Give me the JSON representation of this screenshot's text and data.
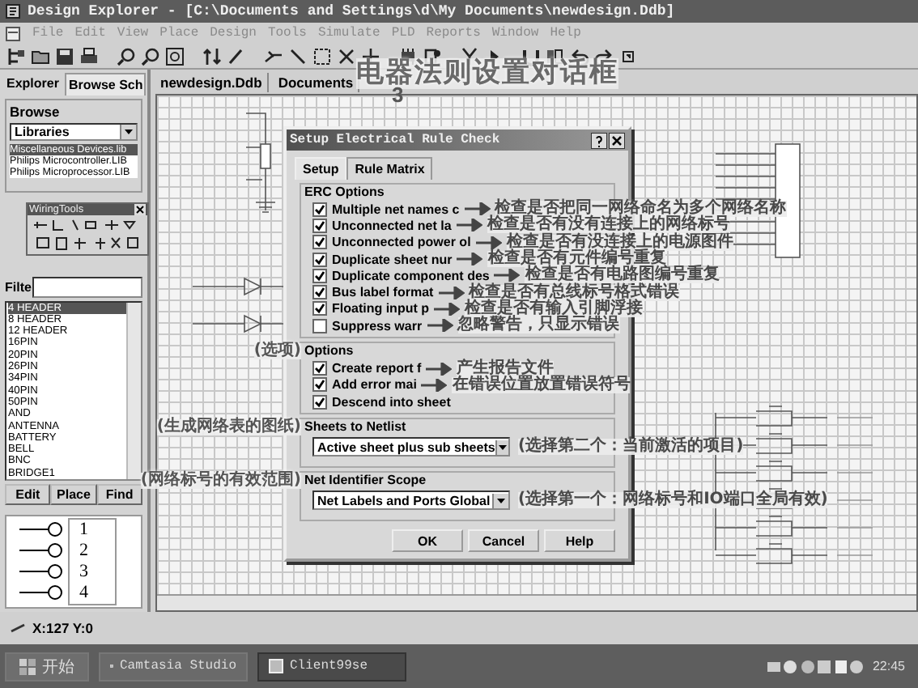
{
  "window": {
    "title": "Design Explorer - [C:\\Documents and Settings\\d\\My Documents\\newdesign.Ddb]"
  },
  "menu": [
    "File",
    "Edit",
    "View",
    "Place",
    "Design",
    "Tools",
    "Simulate",
    "PLD",
    "Reports",
    "Window",
    "Help"
  ],
  "left_panel": {
    "tabs": [
      {
        "label": "Explorer",
        "selected": false
      },
      {
        "label": "Browse Sch",
        "selected": true
      }
    ],
    "browse_label": "Browse",
    "library_select": "Libraries",
    "libraries": [
      {
        "label": "Miscellaneous Devices.lib",
        "selected": true
      },
      {
        "label": "Philips Microcontroller.LIB",
        "selected": false
      },
      {
        "label": "Philips Microprocessor.LIB",
        "selected": false
      }
    ],
    "wiring_tools": {
      "title": "WiringTools"
    },
    "filter_label": "Filte",
    "components": [
      {
        "label": "4 HEADER",
        "selected": true
      },
      {
        "label": "8 HEADER",
        "selected": false
      },
      {
        "label": "12 HEADER",
        "selected": false
      },
      {
        "label": "16PIN",
        "selected": false
      },
      {
        "label": "20PIN",
        "selected": false
      },
      {
        "label": "26PIN",
        "selected": false
      },
      {
        "label": "34PIN",
        "selected": false
      },
      {
        "label": "40PIN",
        "selected": false
      },
      {
        "label": "50PIN",
        "selected": false
      },
      {
        "label": "AND",
        "selected": false
      },
      {
        "label": "ANTENNA",
        "selected": false
      },
      {
        "label": "BATTERY",
        "selected": false
      },
      {
        "label": "BELL",
        "selected": false
      },
      {
        "label": "BNC",
        "selected": false
      },
      {
        "label": "BRIDGE1",
        "selected": false
      }
    ],
    "buttons": [
      "Edit",
      "Place",
      "Find"
    ],
    "preview_pins": [
      "1",
      "2",
      "3",
      "4"
    ]
  },
  "document_tabs": [
    {
      "label": "newdesign.Ddb",
      "selected": false
    },
    {
      "label": "Documents",
      "selected": false
    }
  ],
  "title_annotation": "电器法则设置对话框",
  "title_annotation_mark": "3",
  "dialog": {
    "title": "Setup Electrical Rule Check",
    "tabs": [
      {
        "label": "Setup",
        "selected": true
      },
      {
        "label": "Rule Matrix",
        "selected": false
      }
    ],
    "erc_title": "ERC Options",
    "erc_options": [
      {
        "label": "Multiple net names c",
        "checked": true,
        "note": "检查是否把同一网络命名为多个网络名称"
      },
      {
        "label": "Unconnected net la",
        "checked": true,
        "note": "检查是否有没有连接上的网络标号"
      },
      {
        "label": "Unconnected power ol",
        "checked": true,
        "note": "检查是否有没连接上的电源图件"
      },
      {
        "label": "Duplicate sheet nur",
        "checked": true,
        "note": "检查是否有元件编号重复"
      },
      {
        "label": "Duplicate component des",
        "checked": true,
        "note": "检查是否有电路图编号重复"
      },
      {
        "label": "Bus label format",
        "checked": true,
        "note": "检查是否有总线标号格式错误"
      },
      {
        "label": "Floating input p",
        "checked": true,
        "note": "检查是否有输入引脚浮接"
      },
      {
        "label": "Suppress warr",
        "checked": false,
        "note": "忽略警告，只显示错误"
      }
    ],
    "options_title": "Options",
    "options_note": "(选项)",
    "options": [
      {
        "label": "Create report f",
        "checked": true,
        "note": "产生报告文件"
      },
      {
        "label": "Add error mai",
        "checked": true,
        "note": "在错误位置放置错误符号"
      },
      {
        "label": "Descend into sheet",
        "checked": true
      }
    ],
    "sheets": {
      "title": "Sheets to Netlist",
      "left_note": "(生成网络表的图纸)",
      "value": "Active sheet plus sub sheets",
      "note": "(选择第二个：当前激活的项目)"
    },
    "scope": {
      "title": "Net Identifier Scope",
      "left_note": "(网络标号的有效范围)",
      "value": "Net Labels and Ports Global",
      "note": "(选择第一个：网络标号和IO端口全局有效)"
    },
    "buttons": [
      "OK",
      "Cancel",
      "Help"
    ]
  },
  "status_bar": {
    "coords": "X:127 Y:0"
  },
  "taskbar": {
    "start": "开始",
    "tasks": [
      {
        "label": "Camtasia Studio",
        "selected": false
      },
      {
        "label": "Client99se",
        "selected": true
      }
    ],
    "clock": "22:45"
  }
}
